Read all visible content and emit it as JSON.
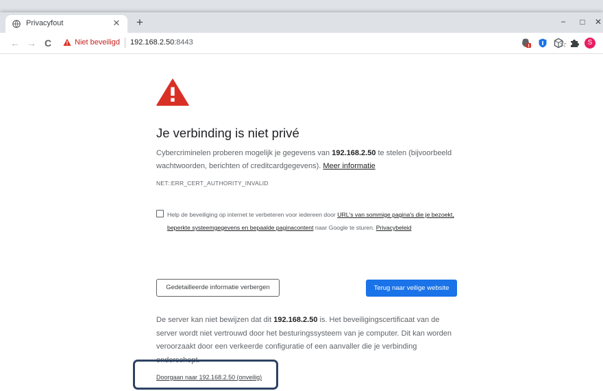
{
  "tab": {
    "title": "Privacyfout",
    "close_glyph": "✕",
    "new_tab_glyph": "+"
  },
  "window_controls": {
    "minimize": "−",
    "maximize": "□",
    "close": "✕"
  },
  "toolbar": {
    "back_glyph": "←",
    "forward_glyph": "→",
    "reload_glyph": "C",
    "security_label": "Niet beveiligd",
    "url_host": "192.168.2.50",
    "url_port": ":8443",
    "star_glyph": "☆",
    "extensions": [
      "alert-extension-icon",
      "shield-extension-icon",
      "cube-extension-icon",
      "puzzle-extension-icon",
      "profile-avatar"
    ],
    "profile_initial": "S"
  },
  "page": {
    "heading": "Je verbinding is niet privé",
    "intro_before": "Cybercriminelen proberen mogelijk je gegevens van ",
    "intro_host": "192.168.2.50",
    "intro_after": " te stelen (bijvoorbeeld wachtwoorden, berichten of creditcardgegevens). ",
    "more_info_link": "Meer informatie",
    "error_code": "NET::ERR_CERT_AUTHORITY_INVALID",
    "optin_before": "Help de beveiliging op internet te verbeteren voor iedereen door ",
    "optin_link": "URL's van sommige pagina's die je bezoekt, beperkte systeemgegevens en bepaalde paginacontent",
    "optin_after": " naar Google te sturen. ",
    "privacy_link": "Privacybeleid",
    "details_button": "Gedetailleerde informatie verbergen",
    "back_button": "Terug naar veilige website",
    "details_before": "De server kan niet bewijzen dat dit ",
    "details_host": "192.168.2.50",
    "details_after": " is. Het beveiligingscertificaat van de server wordt niet vertrouwd door het besturingssysteem van je computer. Dit kan worden veroorzaakt door een verkeerde configuratie of een aanvaller die je verbinding onderschept.",
    "proceed_link": "Doorgaan naar 192.168.2.50 (onveilig)"
  },
  "colors": {
    "warning_red": "#d93025",
    "primary_button": "#1a73e8",
    "highlight_frame": "#2b4262"
  }
}
